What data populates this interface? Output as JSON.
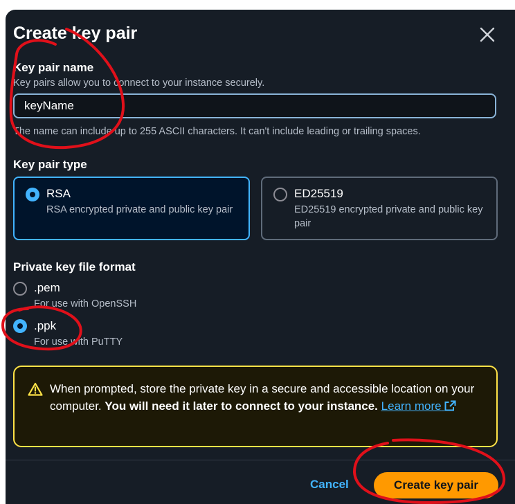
{
  "dialog": {
    "title": "Create key pair"
  },
  "key_pair_name": {
    "label": "Key pair name",
    "description": "Key pairs allow you to connect to your instance securely.",
    "value": "keyName",
    "constraint": "The name can include up to 255 ASCII characters. It can't include leading or trailing spaces."
  },
  "key_pair_type": {
    "label": "Key pair type",
    "options": [
      {
        "title": "RSA",
        "description": "RSA encrypted private and public key pair",
        "selected": true
      },
      {
        "title": "ED25519",
        "description": "ED25519 encrypted private and public key pair",
        "selected": false
      }
    ]
  },
  "private_key_format": {
    "label": "Private key file format",
    "options": [
      {
        "title": ".pem",
        "description": "For use with OpenSSH",
        "selected": false
      },
      {
        "title": ".ppk",
        "description": "For use with PuTTY",
        "selected": true
      }
    ]
  },
  "alert": {
    "text": "When prompted, store the private key in a secure and accessible location on your computer.",
    "bold_text": "You will need it later to connect to your instance.",
    "link_text": "Learn more",
    "icon": "warning-triangle-icon"
  },
  "footer": {
    "cancel_label": "Cancel",
    "create_label": "Create key pair"
  },
  "colors": {
    "background": "#161d26",
    "accent": "#42b4ff",
    "primary_button": "#ff9900",
    "warning_border": "#ffe347",
    "annotation": "#e0101a"
  }
}
